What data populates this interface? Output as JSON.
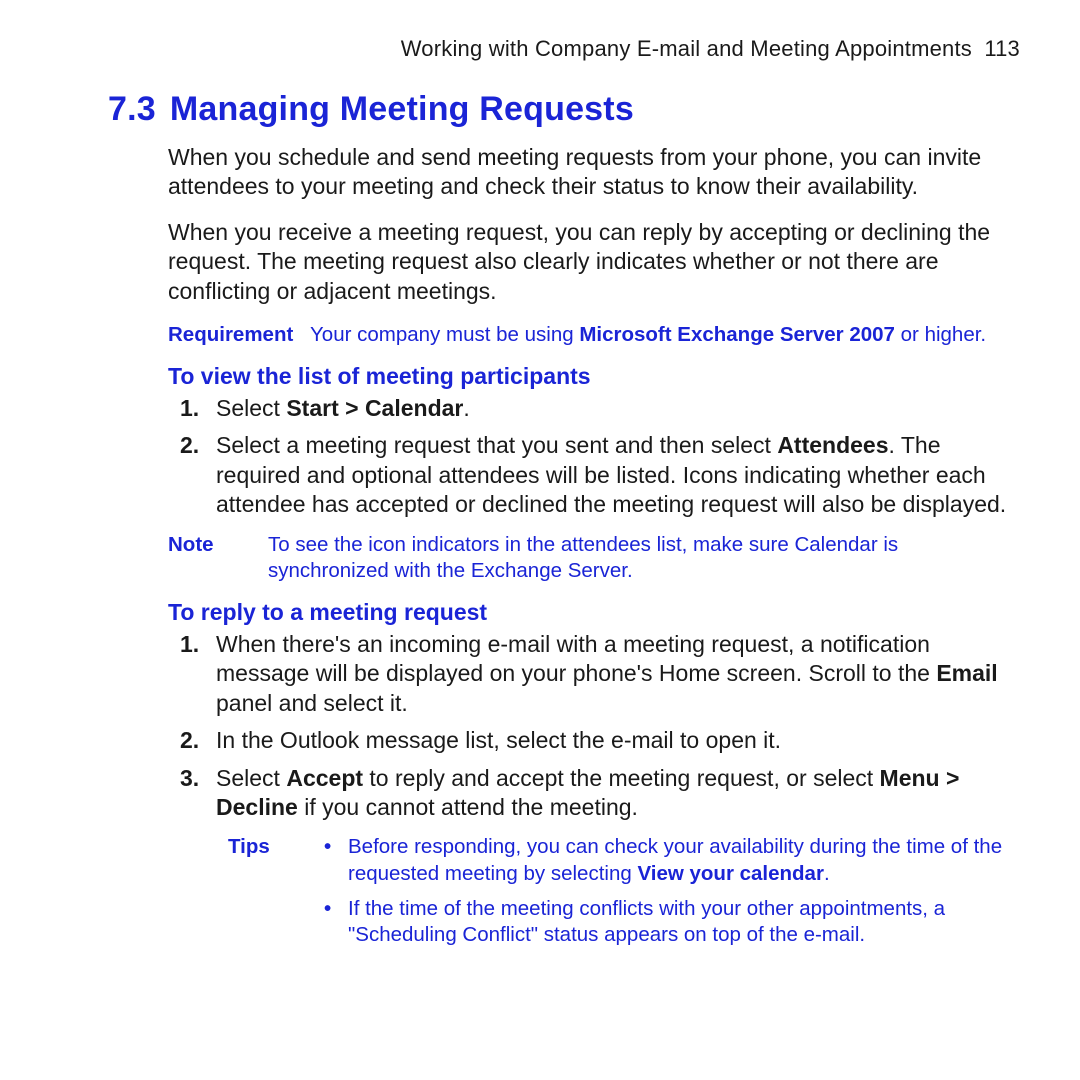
{
  "header": {
    "running_title": "Working with Company E-mail and Meeting Appointments",
    "page_number": "113"
  },
  "section": {
    "number": "7.3",
    "title": "Managing Meeting Requests"
  },
  "intro_paragraphs": [
    "When you schedule and send meeting requests from your phone, you can invite attendees to your meeting and check their status to know their availability.",
    "When you receive a meeting request, you can reply by accepting or declining the request. The meeting request also clearly indicates whether or not there are conflicting or adjacent meetings."
  ],
  "requirement": {
    "label": "Requirement",
    "prefix": "Your company must be using ",
    "bold": "Microsoft Exchange Server 2007",
    "suffix": " or higher."
  },
  "view_participants": {
    "heading": "To view the list of meeting participants",
    "step1_prefix": "Select ",
    "step1_bold": "Start > Calendar",
    "step1_suffix": ".",
    "step2_prefix": "Select a meeting request that you sent and then select ",
    "step2_bold": "Attendees",
    "step2_suffix": ". The required and optional attendees will be listed. Icons indicating whether each attendee has accepted or declined the meeting request will also be displayed."
  },
  "note": {
    "label": "Note",
    "text": "To see the icon indicators in the attendees list, make sure Calendar is synchronized with the Exchange Server."
  },
  "reply_request": {
    "heading": "To reply to a meeting request",
    "step1_prefix": "When there's an incoming e-mail with a meeting request, a notification message will be displayed on your phone's Home screen. Scroll to the ",
    "step1_bold": "Email",
    "step1_suffix": " panel and select it.",
    "step2": "In the Outlook message list, select the e-mail to open it.",
    "step3_p1": "Select ",
    "step3_b1": "Accept",
    "step3_p2": " to reply and accept the meeting request, or select ",
    "step3_b2": "Menu > Decline",
    "step3_p3": " if you cannot attend the meeting."
  },
  "tips": {
    "label": "Tips",
    "tip1_prefix": "Before responding, you can check your availability during the time of the requested meeting by selecting ",
    "tip1_bold": "View your calendar",
    "tip1_suffix": ".",
    "tip2": "If the time of the meeting conflicts with your other appointments, a \"Scheduling Conflict\" status appears on top of the e-mail."
  }
}
